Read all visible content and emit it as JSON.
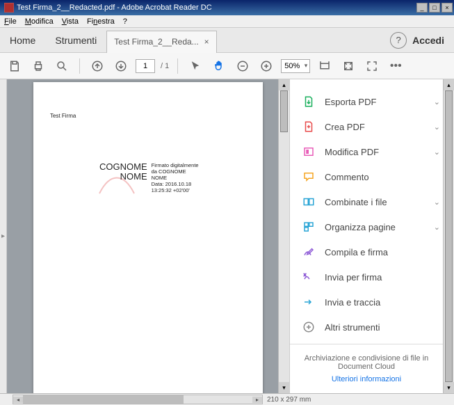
{
  "window": {
    "title": "Test Firma_2__Redacted.pdf - Adobe Acrobat Reader DC"
  },
  "menubar": {
    "file": "File",
    "edit": "Modifica",
    "view": "Vista",
    "window": "Finestra",
    "help": "?"
  },
  "tabs": {
    "home": "Home",
    "tools": "Strumenti",
    "doc": "Test Firma_2__Reda...",
    "signin": "Accedi"
  },
  "toolbar": {
    "page_current": "1",
    "page_total": "/ 1",
    "zoom": "50%"
  },
  "document": {
    "small_title": "Test Firma",
    "sig_name_line1": "COGNOME",
    "sig_name_line2": "NOME",
    "sig_detail1": "Firmato digitalmente",
    "sig_detail2": "da COGNOME",
    "sig_detail3": "NOME",
    "sig_detail4": "Data: 2016.10.18",
    "sig_detail5": "13:25:32 +02'00'"
  },
  "tools_pane": {
    "items": [
      {
        "label": "Esporta PDF",
        "expandable": true
      },
      {
        "label": "Crea PDF",
        "expandable": true
      },
      {
        "label": "Modifica PDF",
        "expandable": true
      },
      {
        "label": "Commento",
        "expandable": false
      },
      {
        "label": "Combinate i file",
        "expandable": true
      },
      {
        "label": "Organizza pagine",
        "expandable": true
      },
      {
        "label": "Compila e firma",
        "expandable": false
      },
      {
        "label": "Invia per firma",
        "expandable": false
      },
      {
        "label": "Invia e traccia",
        "expandable": false
      },
      {
        "label": "Altri strumenti",
        "expandable": false
      }
    ],
    "cloud_text": "Archiviazione e condivisione di file in Document Cloud",
    "cloud_link": "Ulteriori informazioni"
  },
  "statusbar": {
    "dimensions": "210 x 297 mm"
  }
}
